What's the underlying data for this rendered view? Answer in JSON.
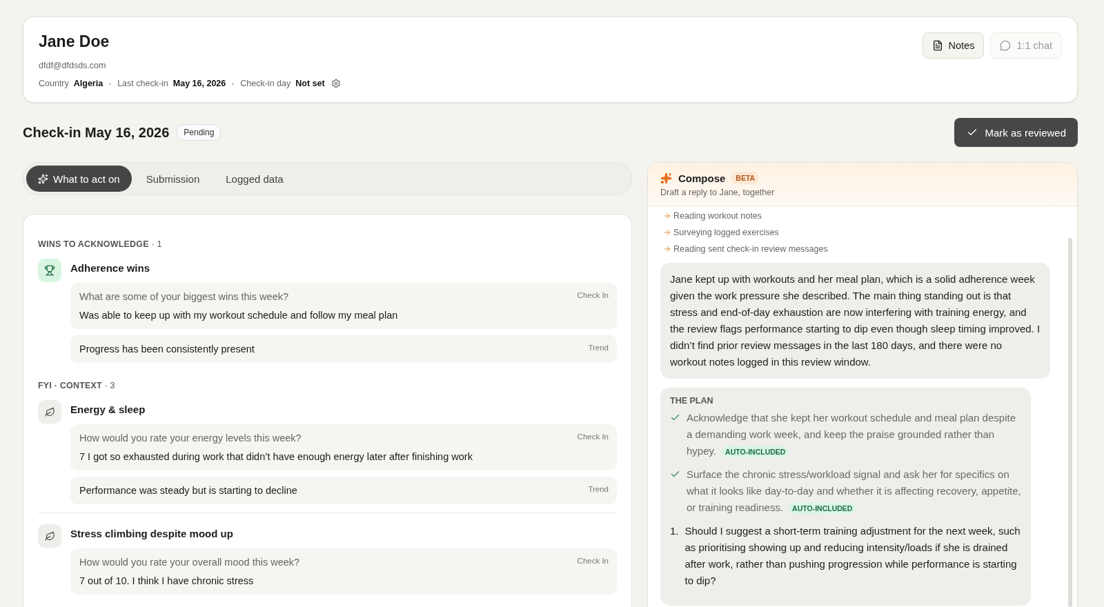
{
  "profile": {
    "name": "Jane Doe",
    "email": "dfdf@dfdsds.com",
    "meta": [
      {
        "label": "Country",
        "value": "Algeria"
      },
      {
        "label": "Last check-in",
        "value": "May 16, 2026"
      },
      {
        "label": "Check-in day",
        "value": "Not set"
      }
    ],
    "actions": [
      {
        "label": "Notes",
        "kind": "notes",
        "disabled": false
      },
      {
        "label": "1:1 chat",
        "kind": "chat",
        "disabled": true
      }
    ]
  },
  "checkin": {
    "title": "Check-in May 16, 2026",
    "status": "Pending",
    "action": "Mark as reviewed"
  },
  "tabs": [
    {
      "label": "What to act on",
      "selected": true
    },
    {
      "label": "Submission",
      "selected": false
    },
    {
      "label": "Logged data",
      "selected": false
    }
  ],
  "sections": [
    {
      "title": "WINS TO ACKNOWLEDGE",
      "count": "· 1",
      "items": [
        {
          "kind": "win",
          "title": "Adherence wins",
          "entries": [
            {
              "question": "What are some of your biggest wins this week?",
              "answer": "Was able to keep up with my workout schedule and follow my meal plan",
              "source": "Check In"
            },
            {
              "answer": "Progress has been consistently present",
              "source": "Trend"
            }
          ]
        }
      ]
    },
    {
      "title": "FYI · CONTEXT",
      "count": "· 3",
      "items": [
        {
          "kind": "context",
          "title": "Energy & sleep",
          "entries": [
            {
              "question": "How would you rate your energy levels this week?",
              "answer": "7 I got so exhausted during work that didn’t have enough energy later after finishing work",
              "source": "Check In"
            },
            {
              "answer": "Performance was steady but is starting to decline",
              "source": "Trend"
            }
          ]
        },
        {
          "kind": "context",
          "title": "Stress climbing despite mood up",
          "entries": [
            {
              "question": "How would you rate your overall mood this week?",
              "answer": "7 out of 10. I think I have chronic stress",
              "source": "Check In"
            }
          ]
        }
      ]
    }
  ],
  "compose": {
    "title": "Compose",
    "badge": "BETA",
    "subtitle": "Draft a reply to Jane, together",
    "steps": [
      "Reading workout notes",
      "Surveying logged exercises",
      "Reading sent check-in review messages"
    ],
    "summary": "Jane kept up with workouts and her meal plan, which is a solid adherence week given the work pressure she described. The main thing standing out is that stress and end-of-day exhaustion are now interfering with training energy, and the review flags performance starting to dip even though sleep timing improved. I didn’t find prior review messages in the last 180 days, and there were no workout notes logged in this review window.",
    "plan": {
      "title": "THE PLAN",
      "items": [
        {
          "kind": "auto",
          "text": "Acknowledge that she kept her workout schedule and meal plan despite a demanding work week, and keep the praise grounded rather than hypey.",
          "badge": "AUTO-INCLUDED"
        },
        {
          "kind": "auto",
          "text": "Surface the chronic stress/workload signal and ask her for specifics on what it looks like day-to-day and whether it is affecting recovery, appetite, or training readiness.",
          "badge": "AUTO-INCLUDED"
        },
        {
          "kind": "question",
          "number": "1.",
          "text": "Should I suggest a short-term training adjustment for the next week, such as prioritising showing up and reducing intensity/loads if she is drained after work, rather than pushing progression while performance is starting to dip?"
        }
      ]
    }
  }
}
